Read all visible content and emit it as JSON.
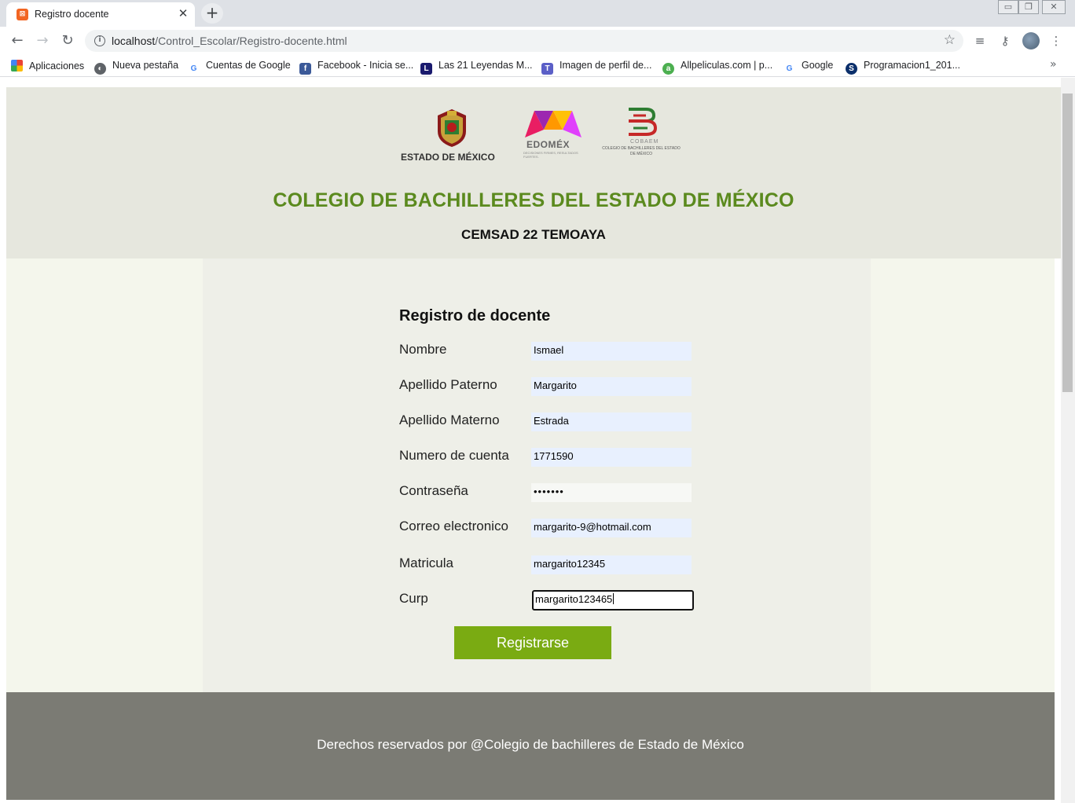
{
  "browser": {
    "tab_title": "Registro docente",
    "url_host": "localhost",
    "url_path": "/Control_Escolar/Registro-docente.html",
    "bookmarks": [
      {
        "label": "Aplicaciones",
        "icon": "apps-grid-icon"
      },
      {
        "label": "Nueva pestaña",
        "icon": "globe-icon"
      },
      {
        "label": "Cuentas de Google",
        "icon": "google-icon"
      },
      {
        "label": "Facebook - Inicia se...",
        "icon": "facebook-icon"
      },
      {
        "label": "Las 21 Leyendas M...",
        "icon": "letter-l-icon"
      },
      {
        "label": "Imagen de perfil de...",
        "icon": "teams-icon"
      },
      {
        "label": "Allpeliculas.com | p...",
        "icon": "allpeliculas-icon"
      },
      {
        "label": "Google",
        "icon": "google-icon"
      },
      {
        "label": "Programacion1_201...",
        "icon": "skype-icon"
      }
    ]
  },
  "header": {
    "logo_captions": {
      "estado": "ESTADO DE MÉXICO",
      "edomex": "EDOMÉX",
      "edomex_tagline": "DECISIONES FIRMES, RESULTADOS FUERTES.",
      "cobaem": "COBAEM",
      "cobaem_full": "COLEGIO DE BACHILLERES DEL ESTADO DE MÉXICO"
    },
    "title": "COLEGIO DE BACHILLERES DEL ESTADO DE MÉXICO",
    "subtitle": "CEMSAD 22 TEMOAYA"
  },
  "form": {
    "heading": "Registro de docente",
    "fields": [
      {
        "label": "Nombre",
        "value": "Ismael"
      },
      {
        "label": "Apellido Paterno",
        "value": "Margarito"
      },
      {
        "label": "Apellido Materno",
        "value": "Estrada"
      },
      {
        "label": "Numero de cuenta",
        "value": "1771590"
      },
      {
        "label": "Contraseña",
        "value": "•••••••"
      },
      {
        "label": "Correo electronico",
        "value": "margarito-9@hotmail.com"
      },
      {
        "label": "Matricula",
        "value": "margarito12345"
      },
      {
        "label": "Curp",
        "value": "margarito123465"
      }
    ],
    "submit_label": "Registrarse"
  },
  "footer": {
    "text": "Derechos reservados por @Colegio de bachilleres de Estado de México"
  },
  "colors": {
    "title_green": "#5b8a1e",
    "button_green": "#7aab12",
    "footer_gray": "#7b7b74"
  }
}
